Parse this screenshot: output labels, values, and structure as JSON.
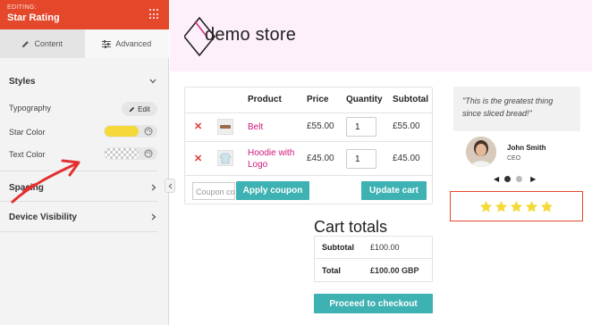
{
  "panel": {
    "editing_label": "EDITING:",
    "title": "Star Rating",
    "tabs": [
      {
        "label": "Content",
        "icon": "pencil-icon",
        "active": false
      },
      {
        "label": "Advanced",
        "icon": "sliders-icon",
        "active": true
      }
    ],
    "styles_heading": "Styles",
    "typography_label": "Typography",
    "edit_button": "Edit",
    "star_color_label": "Star Color",
    "star_color_value": "#f5d93a",
    "text_color_label": "Text Color",
    "spacing_heading": "Spacing",
    "device_visibility_heading": "Device Visibility",
    "accent_color": "#e5472a"
  },
  "store": {
    "logo_text": "demo store"
  },
  "cart": {
    "headers": [
      "Product",
      "Price",
      "Quantity",
      "Subtotal"
    ],
    "items": [
      {
        "name": "Belt",
        "price": "£55.00",
        "quantity": "1",
        "subtotal": "£55.00"
      },
      {
        "name": "Hoodie with Logo",
        "price": "£45.00",
        "quantity": "1",
        "subtotal": "£45.00"
      }
    ],
    "coupon_placeholder": "Coupon code",
    "apply_coupon": "Apply coupon",
    "update_cart": "Update cart",
    "button_color": "#3eb1b2",
    "link_color": "#d1157d"
  },
  "totals": {
    "title": "Cart totals",
    "subtotal_label": "Subtotal",
    "subtotal_value": "£100.00",
    "total_label": "Total",
    "total_value": "£100.00 GBP",
    "checkout_button": "Proceed to checkout"
  },
  "testimonial": {
    "quote": "\"This is the greatest thing since sliced bread!\"",
    "name": "John Smith",
    "role": "CEO",
    "slides": 2,
    "active_slide": 1
  },
  "rating": {
    "value": 5,
    "max": 5,
    "star_color": "#f5d93a"
  }
}
